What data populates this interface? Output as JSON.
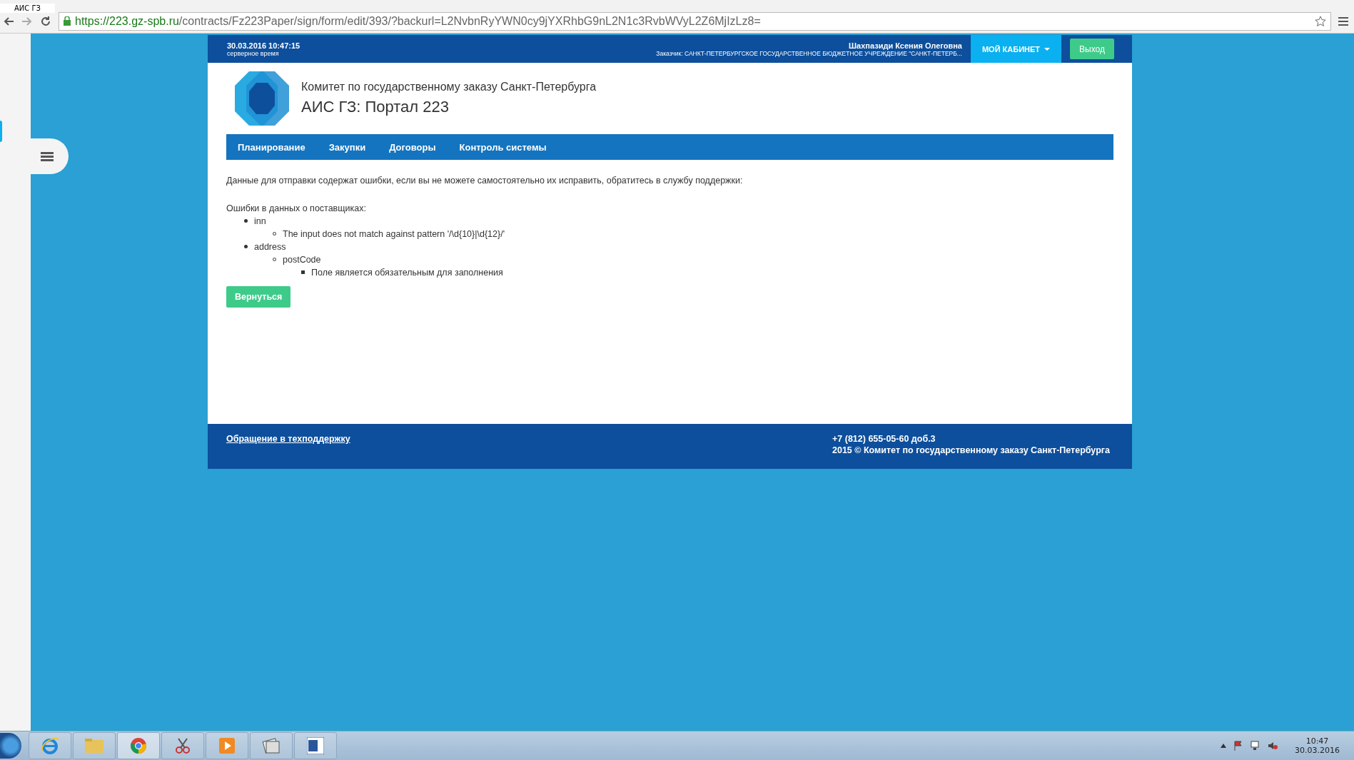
{
  "browser": {
    "tab_title": "АИС ГЗ",
    "url_host": "https://223.gz-spb.ru",
    "url_path": "/contracts/Fz223Paper/sign/form/edit/393/?backurl=L2NvbnRyYWN0cy9jYXRhbG9nL2N1c3RvbWVyL2Z6MjIzLz8="
  },
  "top_bar": {
    "datetime": "30.03.2016 10:47:15",
    "time_caption": "серверное время",
    "user_name": "Шахпазиди Ксения Олеговна",
    "customer": "Заказчик: САНКТ-ПЕТЕРБУРГСКОЕ ГОСУДАРСТВЕННОЕ БЮДЖЕТНОЕ УЧРЕЖДЕНИЕ \"САНКТ-ПЕТЕРБ...",
    "cabinet_button": "МОЙ КАБИНЕТ",
    "logout_button": "Выход"
  },
  "header": {
    "org": "Комитет по государственному заказу Санкт-Петербурга",
    "title": "АИС ГЗ: Портал 223"
  },
  "nav": [
    {
      "label": "Планирование"
    },
    {
      "label": "Закупки"
    },
    {
      "label": "Договоры"
    },
    {
      "label": "Контроль системы"
    }
  ],
  "content": {
    "intro": "Данные для отправки содержат ошибки, если вы не можете самостоятельно их исправить, обратитесь в службу поддержки:",
    "errors_title": "Ошибки в данных о поставщиках:",
    "errors": [
      {
        "text": "inn",
        "children": [
          {
            "text": "The input does not match against pattern '/\\d{10}|\\d{12}/'"
          }
        ]
      },
      {
        "text": "address",
        "children": [
          {
            "text": "postCode",
            "children": [
              {
                "text": "Поле является обязательным для заполнения"
              }
            ]
          }
        ]
      }
    ],
    "back_button": "Вернуться"
  },
  "footer": {
    "support_link": "Обращение в техподдержку",
    "phone": "+7 (812) 655-05-60 доб.3",
    "copyright": "2015 © Комитет по государственному заказу Санкт-Петербурга"
  },
  "taskbar": {
    "time": "10:47",
    "date": "30.03.2016"
  }
}
